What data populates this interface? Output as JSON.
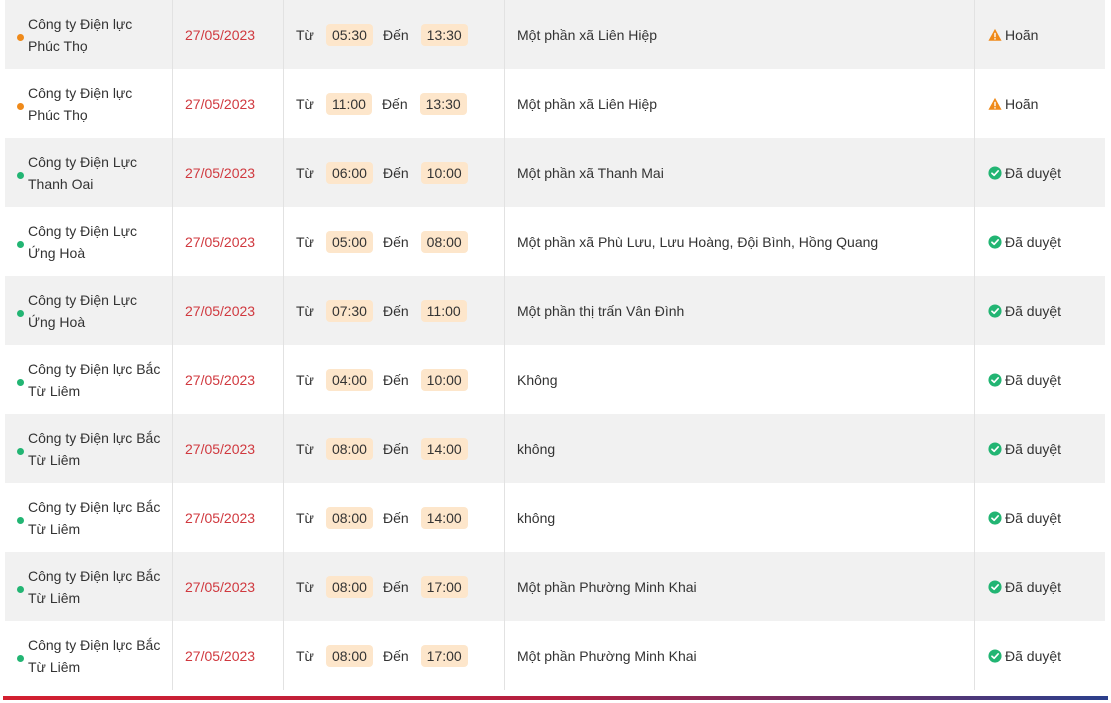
{
  "labels": {
    "from": "Từ",
    "to": "Đến"
  },
  "colors": {
    "status_postponed": "#ef8a1a",
    "status_approved": "#22b573",
    "date_text": "#d0393f",
    "time_chip_bg": "#fde6cb"
  },
  "rows": [
    {
      "company": "Công ty Điện lực Phúc Thọ",
      "company_line1": "Công ty Điện lực",
      "company_line2": "Phúc Thọ",
      "date": "27/05/2023",
      "start": "05:30",
      "end": "13:30",
      "area": "Một phần xã Liên Hiệp",
      "status": "Hoãn",
      "status_type": "postponed",
      "status_icon": "warning-icon"
    },
    {
      "company": "Công ty Điện lực Phúc Thọ",
      "company_line1": "Công ty Điện lực",
      "company_line2": "Phúc Thọ",
      "date": "27/05/2023",
      "start": "11:00",
      "end": "13:30",
      "area": "Một phần xã Liên Hiệp",
      "status": "Hoãn",
      "status_type": "postponed",
      "status_icon": "warning-icon"
    },
    {
      "company": "Công ty Điện Lực Thanh Oai",
      "company_line1": "Công ty Điện Lực",
      "company_line2": "Thanh Oai",
      "date": "27/05/2023",
      "start": "06:00",
      "end": "10:00",
      "area": "Một phần xã Thanh Mai",
      "status": "Đã duyệt",
      "status_type": "approved",
      "status_icon": "check-circle-icon"
    },
    {
      "company": "Công ty Điện Lực Ứng Hoà",
      "company_line1": "Công ty Điện Lực",
      "company_line2": "Ứng Hoà",
      "date": "27/05/2023",
      "start": "05:00",
      "end": "08:00",
      "area": "Một phần xã Phù Lưu, Lưu Hoàng, Đội Bình, Hồng Quang",
      "status": "Đã duyệt",
      "status_type": "approved",
      "status_icon": "check-circle-icon"
    },
    {
      "company": "Công ty Điện Lực Ứng Hoà",
      "company_line1": "Công ty Điện Lực",
      "company_line2": "Ứng Hoà",
      "date": "27/05/2023",
      "start": "07:30",
      "end": "11:00",
      "area": "Một phần thị trấn Vân Đình",
      "status": "Đã duyệt",
      "status_type": "approved",
      "status_icon": "check-circle-icon"
    },
    {
      "company": "Công ty Điện lực Bắc Từ Liêm",
      "company_line1": "Công ty Điện lực Bắc",
      "company_line2": "Từ Liêm",
      "date": "27/05/2023",
      "start": "04:00",
      "end": "10:00",
      "area": "Không",
      "status": "Đã duyệt",
      "status_type": "approved",
      "status_icon": "check-circle-icon"
    },
    {
      "company": "Công ty Điện lực Bắc Từ Liêm",
      "company_line1": "Công ty Điện lực Bắc",
      "company_line2": "Từ Liêm",
      "date": "27/05/2023",
      "start": "08:00",
      "end": "14:00",
      "area": "không",
      "status": "Đã duyệt",
      "status_type": "approved",
      "status_icon": "check-circle-icon"
    },
    {
      "company": "Công ty Điện lực Bắc Từ Liêm",
      "company_line1": "Công ty Điện lực Bắc",
      "company_line2": "Từ Liêm",
      "date": "27/05/2023",
      "start": "08:00",
      "end": "14:00",
      "area": "không",
      "status": "Đã duyệt",
      "status_type": "approved",
      "status_icon": "check-circle-icon"
    },
    {
      "company": "Công ty Điện lực Bắc Từ Liêm",
      "company_line1": "Công ty Điện lực Bắc",
      "company_line2": "Từ Liêm",
      "date": "27/05/2023",
      "start": "08:00",
      "end": "17:00",
      "area": "Một phần Phường Minh Khai",
      "status": "Đã duyệt",
      "status_type": "approved",
      "status_icon": "check-circle-icon"
    },
    {
      "company": "Công ty Điện lực Bắc Từ Liêm",
      "company_line1": "Công ty Điện lực Bắc",
      "company_line2": "Từ Liêm",
      "date": "27/05/2023",
      "start": "08:00",
      "end": "17:00",
      "area": "Một phần Phường Minh Khai",
      "status": "Đã duyệt",
      "status_type": "approved",
      "status_icon": "check-circle-icon"
    }
  ]
}
